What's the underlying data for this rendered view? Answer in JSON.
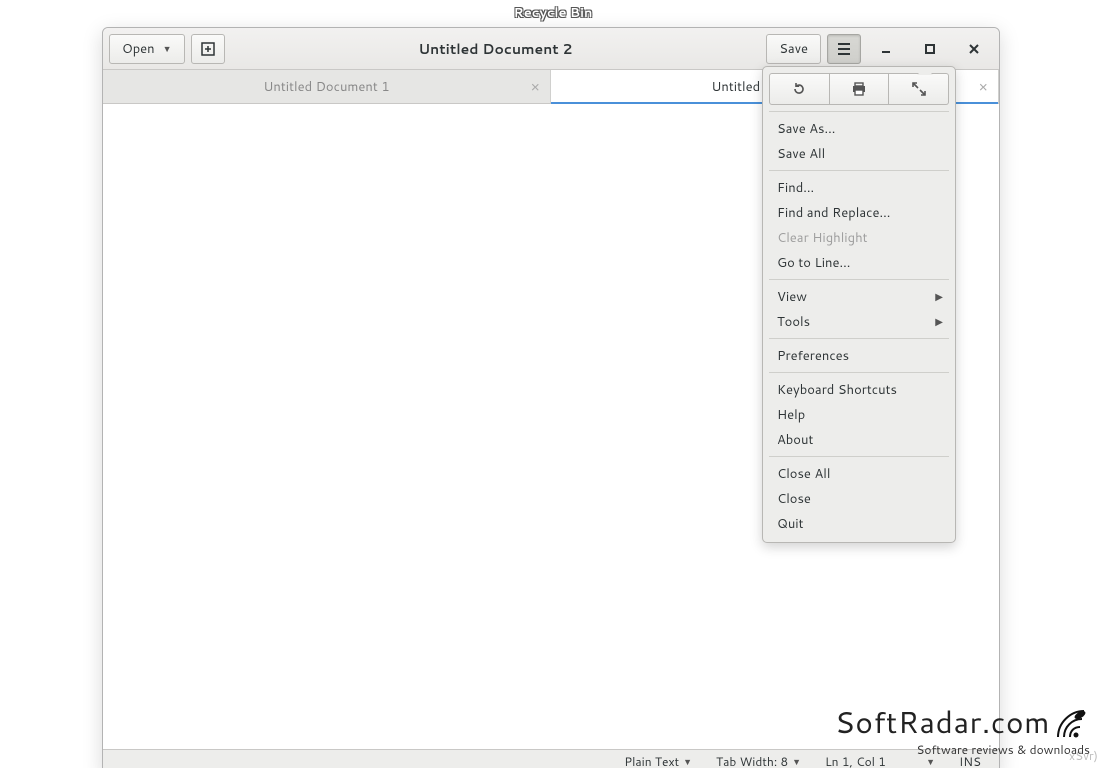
{
  "desktop": {
    "recycle_bin": "Recycle Bin"
  },
  "titlebar": {
    "open_label": "Open",
    "title": "Untitled Document 2",
    "save_label": "Save"
  },
  "tabs": [
    {
      "label": "Untitled Document 1",
      "active": false
    },
    {
      "label": "Untitled Document 2",
      "active": true
    }
  ],
  "menu": {
    "save_as": "Save As...",
    "save_all": "Save All",
    "find": "Find...",
    "find_replace": "Find and Replace...",
    "clear_highlight": "Clear Highlight",
    "go_to_line": "Go to Line...",
    "view": "View",
    "tools": "Tools",
    "preferences": "Preferences",
    "keyboard_shortcuts": "Keyboard Shortcuts",
    "help": "Help",
    "about": "About",
    "close_all": "Close All",
    "close": "Close",
    "quit": "Quit"
  },
  "statusbar": {
    "syntax": "Plain Text",
    "tab_width": "Tab Width: 8",
    "position": "Ln 1, Col 1",
    "insert_mode": "INS"
  },
  "watermark": {
    "brand": "SoftRadar.com",
    "tagline": "Software reviews & downloads"
  },
  "background_text": "xSvr)"
}
